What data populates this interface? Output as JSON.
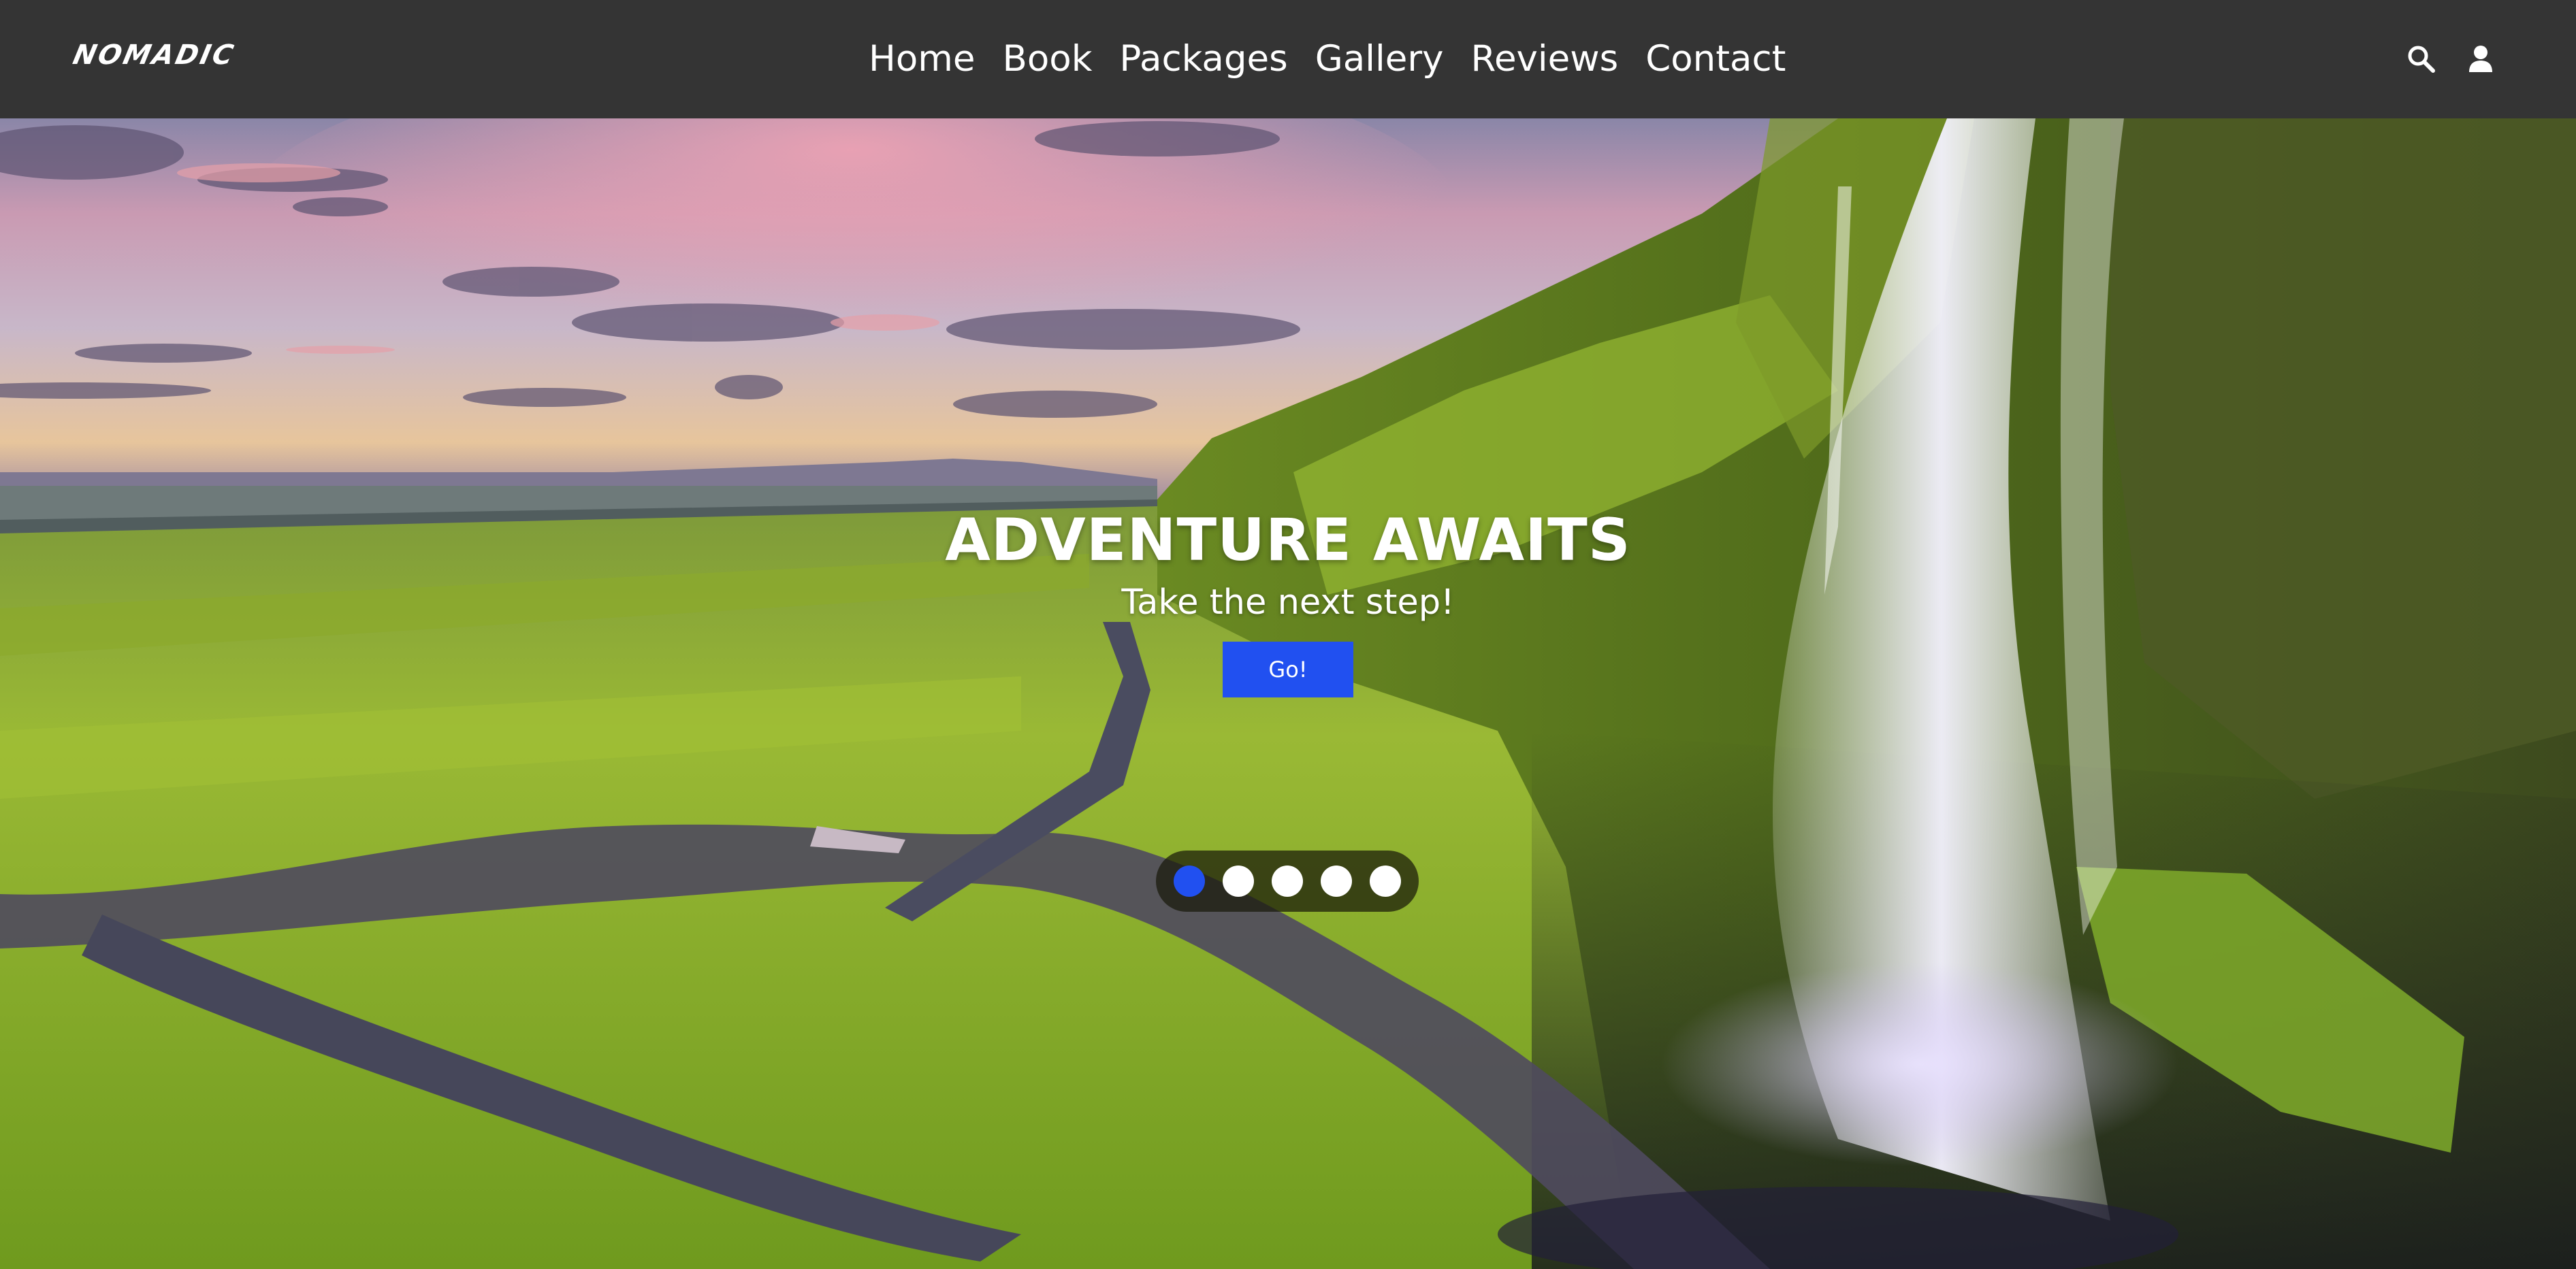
{
  "navbar": {
    "logo": "NOMADIC",
    "links": [
      {
        "label": "Home"
      },
      {
        "label": "Book"
      },
      {
        "label": "Packages"
      },
      {
        "label": "Gallery"
      },
      {
        "label": "Reviews"
      },
      {
        "label": "Contact"
      }
    ],
    "icons": [
      "search-icon",
      "user-icon"
    ]
  },
  "hero": {
    "title": "ADVENTURE AWAITS",
    "subtitle": "Take the next step!",
    "button_label": "Go!",
    "carousel": {
      "total_slides": 5,
      "active_slide": 1
    }
  },
  "colors": {
    "navbar_bg": "#343434",
    "accent": "#2150f0",
    "text": "#ffffff"
  }
}
